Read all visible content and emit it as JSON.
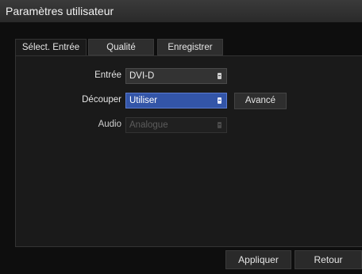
{
  "window": {
    "title": "Paramètres utilisateur"
  },
  "tabs": [
    {
      "label": "Sélect. Entrée",
      "active": true
    },
    {
      "label": "Qualité",
      "active": false
    },
    {
      "label": "Enregistrer",
      "active": false
    }
  ],
  "form": {
    "input": {
      "label": "Entrée",
      "value": "DVI-D"
    },
    "crop": {
      "label": "Découper",
      "value": "Utiliser",
      "advanced_label": "Avancé"
    },
    "audio": {
      "label": "Audio",
      "value": "Analogue",
      "disabled": true
    }
  },
  "footer": {
    "apply_label": "Appliquer",
    "back_label": "Retour"
  },
  "colors": {
    "accent": "#3355a8",
    "background": "#0e0e0e",
    "panel": "#1a1a1a"
  }
}
